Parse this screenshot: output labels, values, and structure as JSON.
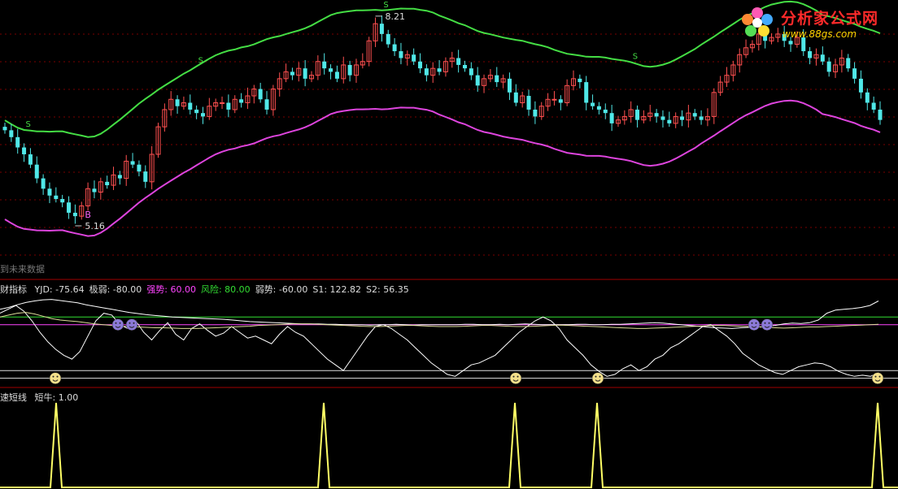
{
  "logo": {
    "text": "分析家公式网",
    "url": "www.88gs.com"
  },
  "main_panel": {
    "future_label": "到未来数据",
    "high_label": "8.21",
    "low_label": "5.16",
    "signal_s": "S",
    "signal_b": "B"
  },
  "indicator_panel": {
    "name": "财指标",
    "items": [
      {
        "label": "YJD: -75.64",
        "color": "#dddddd"
      },
      {
        "label": "极弱: -80.00",
        "color": "#dddddd"
      },
      {
        "label": "强势: 60.00",
        "color": "#ff44ff"
      },
      {
        "label": "风险: 80.00",
        "color": "#33dd33"
      },
      {
        "label": "弱势: -60.00",
        "color": "#dddddd"
      },
      {
        "label": "S1: 122.82",
        "color": "#dddddd"
      },
      {
        "label": "S2: 56.35",
        "color": "#dddddd"
      }
    ]
  },
  "sub_panel": {
    "name": "速短线",
    "items": [
      {
        "label": "短牛: 1.00",
        "color": "#dddddd"
      }
    ]
  },
  "colors": {
    "up": "#ff5050",
    "down": "#50e8e8",
    "upper_band": "#44dd44",
    "lower_band": "#dd44dd",
    "grid": "#7a0000",
    "signal": "#ffff66"
  },
  "chart_data": [
    {
      "type": "candlestick",
      "title": "",
      "price_ylim": [
        4.9,
        8.35
      ],
      "high": 8.21,
      "low": 5.16,
      "closes": [
        6.55,
        6.45,
        6.3,
        6.2,
        6.05,
        5.85,
        5.7,
        5.6,
        5.55,
        5.5,
        5.35,
        5.3,
        5.45,
        5.7,
        5.65,
        5.8,
        5.75,
        5.9,
        5.85,
        6.1,
        6.05,
        5.95,
        5.8,
        6.2,
        6.6,
        6.85,
        7.0,
        6.9,
        6.95,
        6.85,
        6.8,
        6.75,
        6.9,
        6.95,
        6.95,
        6.85,
        7.0,
        6.95,
        7.05,
        7.15,
        7.0,
        6.85,
        7.15,
        7.3,
        7.4,
        7.35,
        7.45,
        7.3,
        7.35,
        7.55,
        7.45,
        7.4,
        7.3,
        7.5,
        7.35,
        7.5,
        7.55,
        7.85,
        8.1,
        7.95,
        7.8,
        7.7,
        7.6,
        7.65,
        7.55,
        7.45,
        7.35,
        7.45,
        7.4,
        7.55,
        7.6,
        7.5,
        7.45,
        7.35,
        7.2,
        7.3,
        7.35,
        7.25,
        7.3,
        7.1,
        6.95,
        7.05,
        6.85,
        6.75,
        6.9,
        7.0,
        7.0,
        6.95,
        7.2,
        7.3,
        7.25,
        6.95,
        6.9,
        6.85,
        6.8,
        6.65,
        6.7,
        6.75,
        6.85,
        6.7,
        6.75,
        6.8,
        6.75,
        6.7,
        6.65,
        6.75,
        6.7,
        6.8,
        6.75,
        6.7,
        6.75,
        7.1,
        7.25,
        7.35,
        7.5,
        7.65,
        7.75,
        7.8,
        7.95,
        7.85,
        7.9,
        7.95,
        7.85,
        7.8,
        7.9,
        7.7,
        7.6,
        7.65,
        7.55,
        7.4,
        7.5,
        7.6,
        7.45,
        7.3,
        7.1,
        6.95,
        6.85,
        6.7
      ]
    },
    {
      "type": "line",
      "title": "",
      "ylim": [
        -85,
        140
      ],
      "reference_lines": {
        "强势": 60,
        "风险": 80,
        "弱势": -60,
        "极弱": -80
      },
      "series": [
        {
          "name": "S1",
          "values": [
            100,
            105,
            112,
            118,
            122,
            125,
            126,
            123,
            120,
            117,
            112,
            108,
            104,
            100,
            96,
            92,
            89,
            86,
            84,
            82,
            80,
            79,
            78,
            77,
            76,
            75,
            74,
            72,
            70,
            68,
            67,
            66,
            65,
            64,
            63,
            62,
            62,
            62,
            61,
            61,
            60,
            60,
            60,
            59,
            60,
            60,
            61,
            60,
            59,
            60,
            60,
            60,
            60,
            60,
            61,
            61,
            60,
            60,
            61,
            60,
            61,
            62,
            61,
            60,
            60,
            60,
            60,
            61,
            61,
            60,
            60,
            61,
            61,
            62,
            63,
            64,
            65,
            64,
            62,
            60,
            58,
            56,
            54,
            52,
            51,
            50,
            52,
            53,
            54,
            55,
            58,
            62,
            64,
            63,
            65,
            72,
            90,
            98,
            100,
            102,
            105,
            110,
            122
          ]
        },
        {
          "name": "S2",
          "values": [
            90,
            100,
            110,
            95,
            70,
            40,
            15,
            -5,
            -20,
            -30,
            -10,
            30,
            70,
            90,
            85,
            60,
            50,
            70,
            40,
            20,
            45,
            65,
            35,
            20,
            50,
            62,
            45,
            30,
            38,
            55,
            40,
            25,
            30,
            20,
            10,
            35,
            55,
            40,
            30,
            10,
            -10,
            -30,
            -45,
            -60,
            -30,
            0,
            30,
            55,
            60,
            50,
            35,
            20,
            0,
            -20,
            -40,
            -55,
            -70,
            -75,
            -60,
            -45,
            -40,
            -30,
            -20,
            0,
            20,
            40,
            55,
            70,
            80,
            70,
            50,
            20,
            0,
            -20,
            -45,
            -62,
            -75,
            -70,
            -55,
            -45,
            -60,
            -50,
            -30,
            -20,
            0,
            10,
            25,
            40,
            55,
            60,
            45,
            30,
            10,
            -15,
            -30,
            -45,
            -55,
            -65,
            -70,
            -60,
            -50,
            -45,
            -40,
            -42,
            -50,
            -62,
            -70,
            -75,
            -72,
            -75,
            -65
          ]
        },
        {
          "name": "YJD",
          "values": [
            80,
            85,
            90,
            92,
            88,
            82,
            76,
            72,
            70,
            68,
            65,
            62,
            60,
            58,
            56,
            55,
            54,
            53,
            52,
            52,
            51,
            50,
            50,
            50,
            51,
            52,
            53,
            54,
            55,
            56,
            58,
            59,
            60,
            61,
            62,
            62,
            62,
            61,
            60,
            59,
            58,
            57,
            56,
            55,
            55,
            56,
            57,
            58,
            58,
            57,
            56,
            55,
            55,
            55,
            56,
            57,
            58,
            58,
            57,
            56,
            55,
            55,
            56,
            57,
            58,
            59,
            58,
            57,
            56,
            55,
            54,
            53,
            52,
            51,
            50,
            50,
            51,
            52,
            53,
            54,
            55,
            56,
            57,
            58,
            58,
            57,
            56,
            55,
            54,
            53,
            52,
            51,
            52,
            53,
            54,
            54,
            55,
            56,
            57,
            58,
            59,
            60,
            61
          ]
        }
      ]
    },
    {
      "type": "line",
      "title": "",
      "series": [
        {
          "name": "短牛",
          "values": [
            0,
            1,
            0,
            1,
            0,
            1,
            0,
            1,
            0,
            1,
            0
          ]
        }
      ]
    }
  ]
}
